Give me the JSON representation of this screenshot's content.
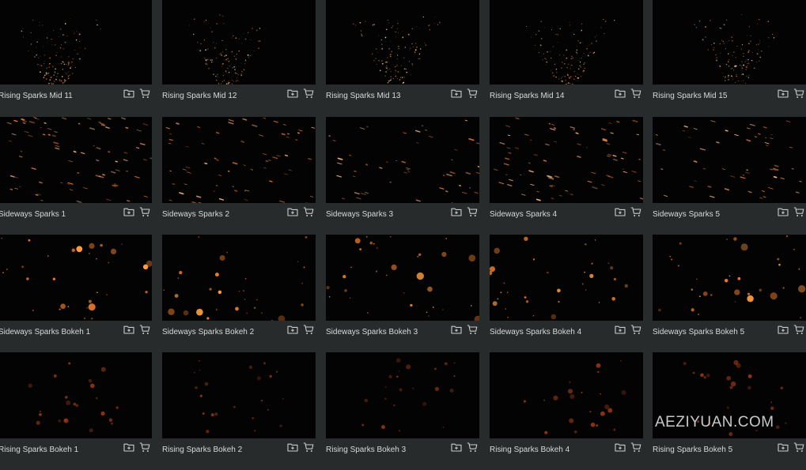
{
  "grid": {
    "rows": [
      [
        "Rising Sparks Mid 11",
        "Rising Sparks Mid 12",
        "Rising Sparks Mid 13",
        "Rising Sparks Mid 14",
        "Rising Sparks Mid 15"
      ],
      [
        "Sideways Sparks 1",
        "Sideways Sparks 2",
        "Sideways Sparks 3",
        "Sideways Sparks 4",
        "Sideways Sparks 5"
      ],
      [
        "Sideways Sparks Bokeh 1",
        "Sideways Sparks Bokeh 2",
        "Sideways Sparks Bokeh 3",
        "Sideways Sparks Bokeh 4",
        "Sideways Sparks Bokeh 5"
      ],
      [
        "Rising Sparks Bokeh 1",
        "Rising Sparks Bokeh 2",
        "Rising Sparks Bokeh 3",
        "Rising Sparks Bokeh 4",
        "Rising Sparks Bokeh 5"
      ]
    ],
    "row_styles": [
      "rising-mid",
      "sideways",
      "sideways-bokeh",
      "rising-bokeh"
    ],
    "card_icons": [
      "add-to-folder-icon",
      "cart-icon"
    ]
  },
  "colors": {
    "background": "#272b2c",
    "thumbnail": "#030303",
    "caption": "#d7d9da",
    "icon": "#c9cccd",
    "spark": "#e8782a"
  },
  "watermark": "AEZIYUAN.COM"
}
